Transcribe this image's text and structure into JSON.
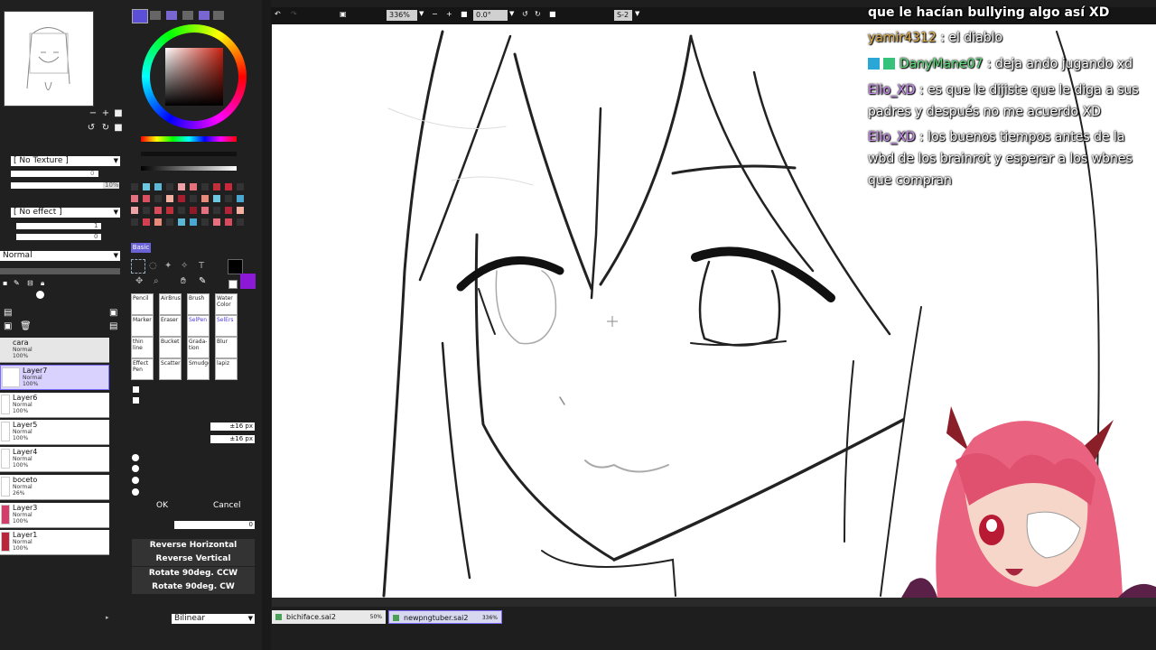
{
  "layers_panel": {
    "texture_dropdown": "[ No Texture ]",
    "effect_dropdown": "[ No effect ]",
    "texture_scale": "0",
    "texture_strength": "10%",
    "effect_value1": "1",
    "effect_value2": "0",
    "blend_mode": "Normal",
    "layers": [
      {
        "name": "cara",
        "mode": "Normal",
        "opacity": "100%"
      },
      {
        "name": "Layer7",
        "mode": "Normal",
        "opacity": "100%"
      },
      {
        "name": "Layer6",
        "mode": "Normal",
        "opacity": "100%"
      },
      {
        "name": "Layer5",
        "mode": "Normal",
        "opacity": "100%"
      },
      {
        "name": "Layer4",
        "mode": "Normal",
        "opacity": "100%"
      },
      {
        "name": "boceto",
        "mode": "Normal",
        "opacity": "26%"
      },
      {
        "name": "Layer3",
        "mode": "Normal",
        "opacity": "100%"
      },
      {
        "name": "Layer1",
        "mode": "Normal",
        "opacity": "100%"
      }
    ]
  },
  "tools": {
    "palette_tab": "Basic",
    "brushes": [
      {
        "name": "Pencil"
      },
      {
        "name": "AirBrush"
      },
      {
        "name": "Brush"
      },
      {
        "name": "Water Color"
      },
      {
        "name": "Marker"
      },
      {
        "name": "Eraser"
      },
      {
        "name": "SelPen"
      },
      {
        "name": "SelErs"
      },
      {
        "name": "thin line"
      },
      {
        "name": "Bucket"
      },
      {
        "name": "Grada-tion"
      },
      {
        "name": "Blur"
      },
      {
        "name": "Effect Pen"
      },
      {
        "name": "Scatter"
      },
      {
        "name": "Smudge"
      },
      {
        "name": "lapiz"
      }
    ],
    "move_px_1": "±16 px",
    "move_px_2": "±16 px",
    "ok_label": "OK",
    "cancel_label": "Cancel",
    "perspective_value": "0",
    "reverse_horizontal": "Reverse Horizontal",
    "reverse_vertical": "Reverse Vertical",
    "rotate_ccw": "Rotate 90deg. CCW",
    "rotate_cw": "Rotate 90deg. CW",
    "interpolation": "Bilinear",
    "colors": {
      "primary": "#000000",
      "secondary": "#8b19d6"
    }
  },
  "toolbar": {
    "zoom": "336%",
    "rotation": "0.0°",
    "stabilizer": "S-2"
  },
  "tabs": [
    {
      "name": "bichiface.sai2",
      "zoom": "50%"
    },
    {
      "name": "newpngtuber.sai2",
      "zoom": "336%"
    }
  ],
  "chat": {
    "top_line": "que le hacían bullying algo así XD",
    "messages": [
      {
        "user": "yamir4312",
        "text": ": el diablo",
        "color": "#e0b04a"
      },
      {
        "user": "DanyMane07",
        "text": ": deja ando jugando xd",
        "color": "#5ee07c"
      },
      {
        "user": "Elio_XD",
        "text": ": es que le dijiste que le diga a sus padres y después no me acuerdo XD",
        "color": "#c98cf0"
      },
      {
        "user": "Elio_XD",
        "text": ": los buenos tiempos antes de la wbd de los brainrot y esperar a los wbnes que compran",
        "color": "#c98cf0"
      }
    ]
  }
}
